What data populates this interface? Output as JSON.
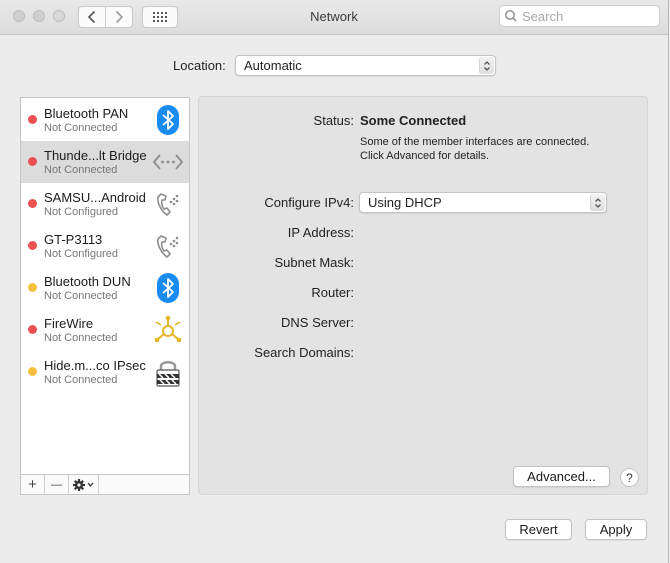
{
  "window": {
    "title": "Network"
  },
  "search": {
    "placeholder": "Search"
  },
  "location": {
    "label": "Location:",
    "value": "Automatic"
  },
  "services": [
    {
      "name": "Bluetooth PAN",
      "status": "Not Connected",
      "status_color": "#ec5152",
      "icon": "bluetooth-icon"
    },
    {
      "name": "Thunde...lt Bridge",
      "status": "Not Connected",
      "status_color": "#ec5152",
      "icon": "bridge-arrows-icon"
    },
    {
      "name": "SAMSU...Android",
      "status": "Not Configured",
      "status_color": "#ec5152",
      "icon": "phone-icon"
    },
    {
      "name": "GT-P3113",
      "status": "Not Configured",
      "status_color": "#ec5152",
      "icon": "phone-icon"
    },
    {
      "name": "Bluetooth DUN",
      "status": "Not Connected",
      "status_color": "#f6bf3e",
      "icon": "bluetooth-icon"
    },
    {
      "name": "FireWire",
      "status": "Not Connected",
      "status_color": "#ec5152",
      "icon": "firewire-icon"
    },
    {
      "name": "Hide.m...co IPsec",
      "status": "Not Connected",
      "status_color": "#f6bf3e",
      "icon": "vpn-lock-icon"
    }
  ],
  "list_toolbar": {
    "add": "+",
    "remove": "—"
  },
  "detail": {
    "status_label": "Status:",
    "status_value": "Some Connected",
    "status_desc_1": "Some of the member interfaces are connected.",
    "status_desc_2": "Click Advanced for details.",
    "configure_label": "Configure IPv4:",
    "configure_value": "Using DHCP",
    "ip_label": "IP Address:",
    "subnet_label": "Subnet Mask:",
    "router_label": "Router:",
    "dns_label": "DNS Server:",
    "search_domains_label": "Search Domains:",
    "advanced_button": "Advanced...",
    "help": "?"
  },
  "footer": {
    "revert": "Revert",
    "apply": "Apply"
  },
  "colors": {
    "bluetooth": "#1a8bf0",
    "status_red": "#ec5152",
    "status_yellow": "#f6bf3e"
  }
}
